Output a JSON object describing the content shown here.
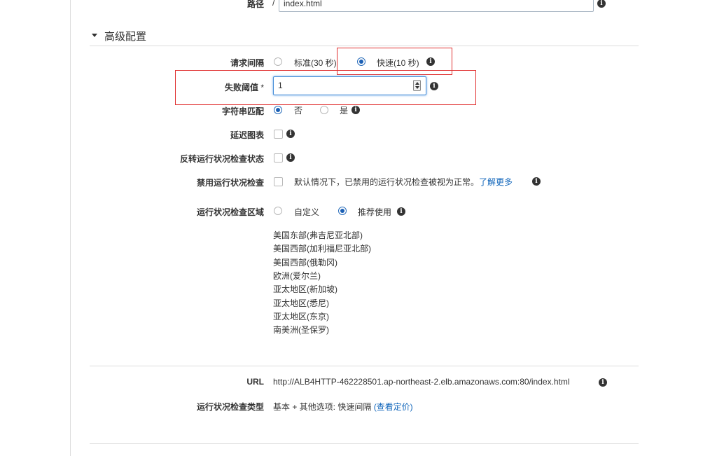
{
  "path": {
    "label": "路径",
    "prefix": "/",
    "value": "index.html"
  },
  "advanced": {
    "title": "高级配置"
  },
  "interval": {
    "label": "请求间隔",
    "options": [
      {
        "label": "标准(30 秒)",
        "selected": false
      },
      {
        "label": "快速(10 秒)",
        "selected": true
      }
    ]
  },
  "threshold": {
    "label": "失败阈值",
    "required_mark": "*",
    "value": "1"
  },
  "string_match": {
    "label": "字符串匹配",
    "options": [
      {
        "label": "否",
        "selected": true
      },
      {
        "label": "是",
        "selected": false
      }
    ]
  },
  "latency_graph": {
    "label": "延迟图表"
  },
  "invert": {
    "label": "反转运行状况检查状态"
  },
  "disable": {
    "label": "禁用运行状况检查",
    "text": "默认情况下，已禁用的运行状况检查被视为正常。",
    "link": "了解更多"
  },
  "regions": {
    "label": "运行状况检查区域",
    "options": [
      {
        "label": "自定义",
        "selected": false
      },
      {
        "label": "推荐使用",
        "selected": true
      }
    ],
    "list": [
      "美国东部(弗吉尼亚北部)",
      "美国西部(加利福尼亚北部)",
      "美国西部(俄勒冈)",
      "欧洲(爱尔兰)",
      "亚太地区(新加坡)",
      "亚太地区(悉尼)",
      "亚太地区(东京)",
      "南美洲(圣保罗)"
    ]
  },
  "url": {
    "label": "URL",
    "value": "http://ALB4HTTP-462228501.ap-northeast-2.elb.amazonaws.com:80/index.html"
  },
  "check_type": {
    "label": "运行状况检查类型",
    "value": "基本 + 其他选项: 快速间隔 ",
    "link": "(查看定价)"
  },
  "colors": {
    "accent": "#1a5fb4",
    "link": "#1166bb",
    "highlight": "#e03030"
  }
}
